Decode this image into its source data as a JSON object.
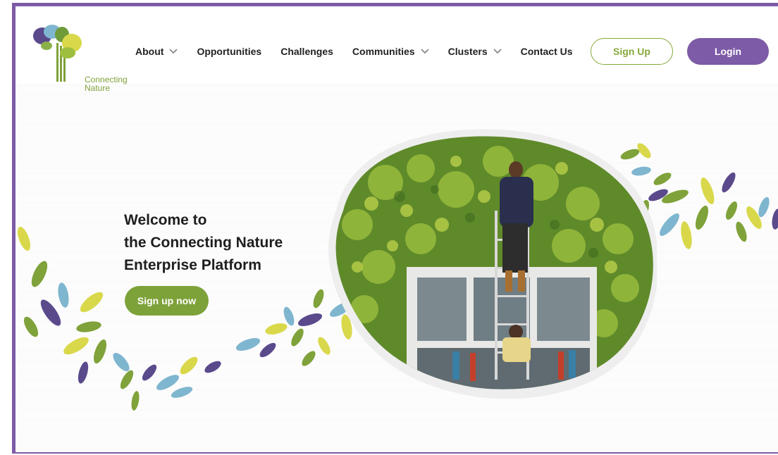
{
  "brand": {
    "logo_text_line1": "Connecting",
    "logo_text_line2": "Nature",
    "accent_purple": "#7d5ba6",
    "accent_green": "#7ea23a"
  },
  "nav": {
    "items": [
      {
        "label": "About",
        "has_dropdown": true
      },
      {
        "label": "Opportunities",
        "has_dropdown": false
      },
      {
        "label": "Challenges",
        "has_dropdown": false
      },
      {
        "label": "Communities",
        "has_dropdown": true
      },
      {
        "label": "Clusters",
        "has_dropdown": true
      },
      {
        "label": "Contact Us",
        "has_dropdown": false
      }
    ],
    "signup_label": "Sign Up",
    "login_label": "Login"
  },
  "hero": {
    "title_line1": "Welcome to",
    "title_line2": "the Connecting Nature",
    "title_line3": "Enterprise Platform",
    "cta_label": "Sign up now"
  }
}
